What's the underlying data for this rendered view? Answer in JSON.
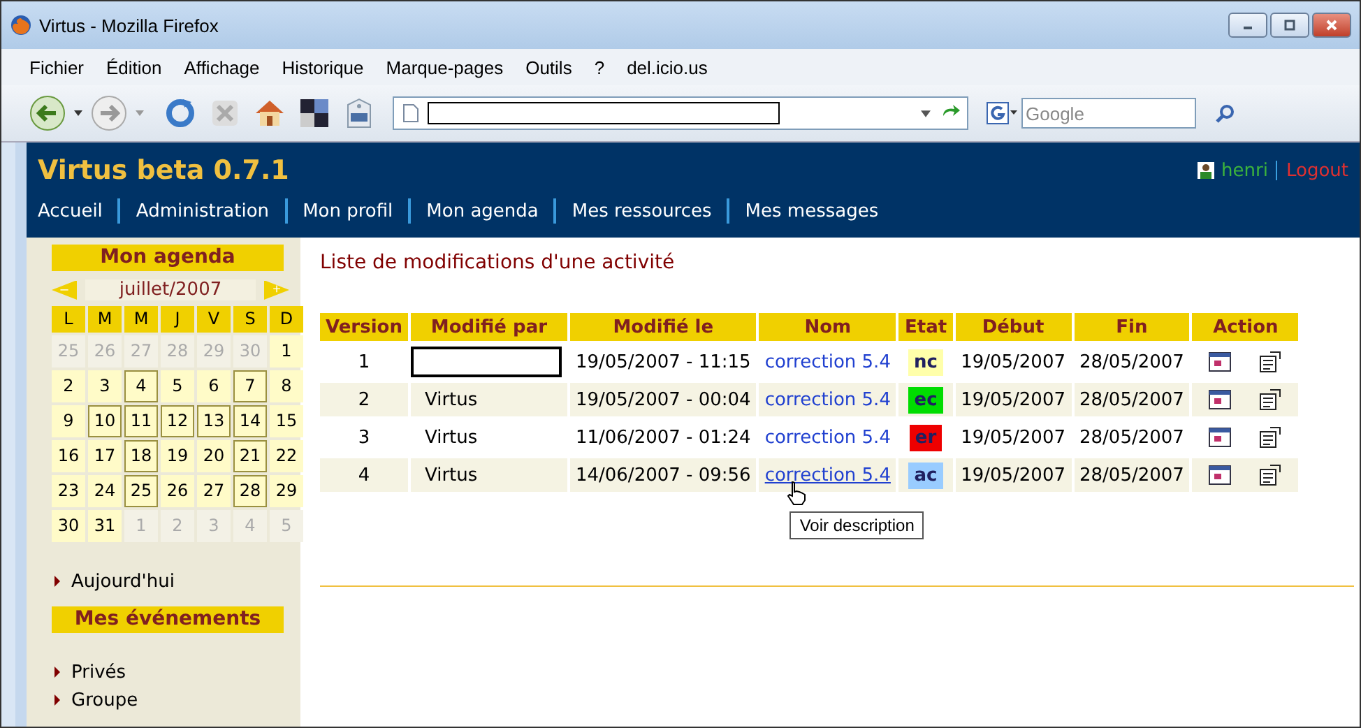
{
  "window": {
    "title": "Virtus - Mozilla Firefox"
  },
  "menu": [
    "Fichier",
    "Édition",
    "Affichage",
    "Historique",
    "Marque-pages",
    "Outils",
    "?",
    "del.icio.us"
  ],
  "address_bar": {
    "redacted": true
  },
  "search": {
    "placeholder": "Google"
  },
  "site": {
    "title": "Virtus beta 0.7.1",
    "user": "henri",
    "logout": "Logout"
  },
  "nav": [
    "Accueil",
    "Administration",
    "Mon profil",
    "Mon agenda",
    "Mes ressources",
    "Mes messages"
  ],
  "sidebar": {
    "agenda_title": "Mon agenda",
    "month": "juillet/2007",
    "prev": "–",
    "next": "+",
    "weekdays": [
      "L",
      "M",
      "M",
      "J",
      "V",
      "S",
      "D"
    ],
    "days": [
      {
        "label": "25",
        "kind": "other",
        "marked": false
      },
      {
        "label": "26",
        "kind": "other",
        "marked": false
      },
      {
        "label": "27",
        "kind": "other",
        "marked": false
      },
      {
        "label": "28",
        "kind": "other",
        "marked": false
      },
      {
        "label": "29",
        "kind": "other",
        "marked": false
      },
      {
        "label": "30",
        "kind": "other",
        "marked": false
      },
      {
        "label": "1",
        "kind": "month",
        "marked": false
      },
      {
        "label": "2",
        "kind": "month",
        "marked": false
      },
      {
        "label": "3",
        "kind": "month",
        "marked": false
      },
      {
        "label": "4",
        "kind": "month",
        "marked": true
      },
      {
        "label": "5",
        "kind": "month",
        "marked": false
      },
      {
        "label": "6",
        "kind": "month",
        "marked": false
      },
      {
        "label": "7",
        "kind": "month",
        "marked": true
      },
      {
        "label": "8",
        "kind": "month",
        "marked": false
      },
      {
        "label": "9",
        "kind": "month",
        "marked": false
      },
      {
        "label": "10",
        "kind": "month",
        "marked": true
      },
      {
        "label": "11",
        "kind": "month",
        "marked": true
      },
      {
        "label": "12",
        "kind": "month",
        "marked": true
      },
      {
        "label": "13",
        "kind": "month",
        "marked": true
      },
      {
        "label": "14",
        "kind": "month",
        "marked": true
      },
      {
        "label": "15",
        "kind": "month",
        "marked": false
      },
      {
        "label": "16",
        "kind": "month",
        "marked": false
      },
      {
        "label": "17",
        "kind": "month",
        "marked": false
      },
      {
        "label": "18",
        "kind": "month",
        "marked": true
      },
      {
        "label": "19",
        "kind": "month",
        "marked": false
      },
      {
        "label": "20",
        "kind": "month",
        "marked": false
      },
      {
        "label": "21",
        "kind": "month",
        "marked": true
      },
      {
        "label": "22",
        "kind": "month",
        "marked": false
      },
      {
        "label": "23",
        "kind": "month",
        "marked": false
      },
      {
        "label": "24",
        "kind": "month",
        "marked": false
      },
      {
        "label": "25",
        "kind": "month",
        "marked": true
      },
      {
        "label": "26",
        "kind": "month",
        "marked": false
      },
      {
        "label": "27",
        "kind": "month",
        "marked": false
      },
      {
        "label": "28",
        "kind": "month",
        "marked": true
      },
      {
        "label": "29",
        "kind": "month",
        "marked": false
      },
      {
        "label": "30",
        "kind": "month",
        "marked": false
      },
      {
        "label": "31",
        "kind": "month",
        "marked": false
      },
      {
        "label": "1",
        "kind": "other",
        "marked": false
      },
      {
        "label": "2",
        "kind": "other",
        "marked": false
      },
      {
        "label": "3",
        "kind": "other",
        "marked": false
      },
      {
        "label": "4",
        "kind": "other",
        "marked": false
      },
      {
        "label": "5",
        "kind": "other",
        "marked": false
      }
    ],
    "today_link": "Aujourd'hui",
    "events_title": "Mes événements",
    "event_links": [
      "Privés",
      "Groupe"
    ]
  },
  "content": {
    "heading": "Liste de modifications d'une activité",
    "table": {
      "columns": [
        "Version",
        "Modifié par",
        "Modifié le",
        "Nom",
        "Etat",
        "Début",
        "Fin",
        "Action"
      ],
      "rows": [
        {
          "version": "1",
          "modified_by": "",
          "redacted": true,
          "modified_on": "19/05/2007 - 11:15",
          "name": "correction 5.4",
          "hovered": false,
          "state": "nc",
          "color": "#ffffaa",
          "start": "19/05/2007",
          "end": "28/05/2007"
        },
        {
          "version": "2",
          "modified_by": "Virtus",
          "redacted": false,
          "modified_on": "19/05/2007 - 00:04",
          "name": "correction 5.4",
          "hovered": false,
          "state": "ec",
          "color": "#00dd00",
          "start": "19/05/2007",
          "end": "28/05/2007"
        },
        {
          "version": "3",
          "modified_by": "Virtus",
          "redacted": false,
          "modified_on": "11/06/2007 - 01:24",
          "name": "correction 5.4",
          "hovered": false,
          "state": "er",
          "color": "#ee0000",
          "start": "19/05/2007",
          "end": "28/05/2007"
        },
        {
          "version": "4",
          "modified_by": "Virtus",
          "redacted": false,
          "modified_on": "14/06/2007 - 09:56",
          "name": "correction 5.4",
          "hovered": true,
          "state": "ac",
          "color": "#99ccff",
          "start": "19/05/2007",
          "end": "28/05/2007"
        }
      ]
    },
    "tooltip": "Voir description"
  }
}
